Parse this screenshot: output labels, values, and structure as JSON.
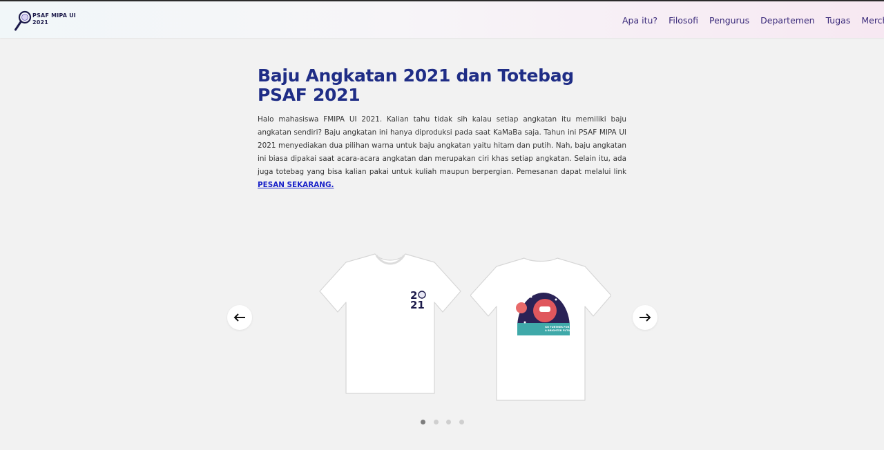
{
  "brand": {
    "name_line1": "PSAF MIPA UI",
    "name_line2": "2021"
  },
  "nav": {
    "items": [
      {
        "label": "Apa itu?"
      },
      {
        "label": "Filosofi"
      },
      {
        "label": "Pengurus"
      },
      {
        "label": "Departemen"
      },
      {
        "label": "Tugas"
      },
      {
        "label": "Merch"
      }
    ]
  },
  "main": {
    "title": "Baju Angkatan 2021 dan Totebag PSAF 2021",
    "description": "Halo mahasiswa FMIPA UI 2021. Kalian tahu tidak sih kalau setiap angkatan itu memiliki baju angkatan sendiri? Baju angkatan ini hanya diproduksi pada saat KaMaBa saja. Tahun ini PSAF MIPA UI 2021 menyediakan dua pilihan warna untuk baju angkatan yaitu hitam dan putih. Nah, baju angkatan ini biasa dipakai saat acara-acara angkatan dan merupakan ciri khas setiap angkatan. Selain itu, ada juga totebag yang bisa kalian pakai untuk kuliah maupun berpergian. Pemesanan dapat melalui link ",
    "link_label": "PESAN SEKARANG."
  },
  "carousel": {
    "prev_icon": "arrow-left-icon",
    "next_icon": "arrow-right-icon",
    "slide_count": 4,
    "active_index": 0,
    "front_print": {
      "top": "2",
      "bottom": "21"
    },
    "back_print": {
      "line1": "GO FURTHER FOR",
      "line2": "A BRIGHTER FUTURE"
    }
  },
  "colors": {
    "title": "#1f2d86",
    "nav_text": "#3a2a7a",
    "link": "#1a23c9",
    "background": "#f2f2f2"
  }
}
